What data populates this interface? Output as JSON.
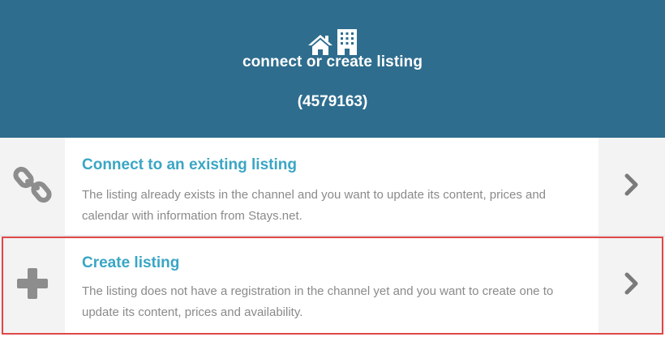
{
  "header": {
    "icons": [
      "home-icon",
      "building-icon"
    ],
    "title": "connect or create listing",
    "listing_id": "(4579163)",
    "background": "#2e6d8e"
  },
  "options": [
    {
      "icon": "link-icon",
      "title": "Connect to an existing listing",
      "description": "The listing already exists in the channel and you want to update its content, prices and calendar with information from Stays.net.",
      "arrow": "chevron-right-icon"
    },
    {
      "icon": "plus-icon",
      "title": "Create listing",
      "description": "The listing does not have a registration in the channel yet and you want to create one to update its content, prices and availability.",
      "arrow": "chevron-right-icon",
      "highlighted": true
    }
  ],
  "colors": {
    "accent": "#3aa6c4",
    "muted_text": "#8a8a8a",
    "side_panel": "#f3f3f3",
    "highlight_border": "#e04848"
  }
}
